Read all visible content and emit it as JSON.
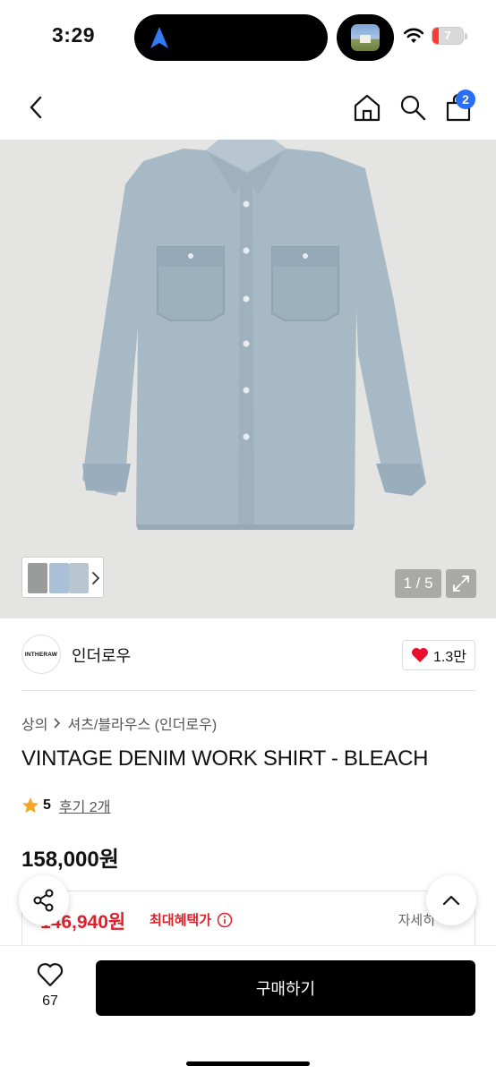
{
  "status_bar": {
    "time": "3:29",
    "battery": "7"
  },
  "header": {
    "cart_count": "2"
  },
  "gallery": {
    "counter": "1 / 5"
  },
  "brand": {
    "logo_text": "INTHERAW",
    "name": "인더로우",
    "likes": "1.3만"
  },
  "breadcrumb": {
    "level1": "상의",
    "level2": "셔츠/블라우스 (인더로우)"
  },
  "product": {
    "title": "VINTAGE DENIM WORK SHIRT - BLEACH",
    "rating": "5",
    "reviews": "후기 2개",
    "price": "158,000원"
  },
  "benefit": {
    "price": "146,940원",
    "label": "최대혜택가",
    "detail": "자세히"
  },
  "bottom_bar": {
    "wish_count": "67",
    "buy_label": "구매하기"
  },
  "colors": {
    "accent_blue": "#2b6ef6",
    "sale_red": "#e0202b",
    "heart_red": "#e8102c",
    "star": "#f5a623"
  },
  "icons": [
    "back-icon",
    "home-icon",
    "search-icon",
    "cart-icon",
    "expand-icon",
    "heart-icon",
    "star-icon",
    "info-icon",
    "share-icon",
    "chevron-up-icon"
  ]
}
